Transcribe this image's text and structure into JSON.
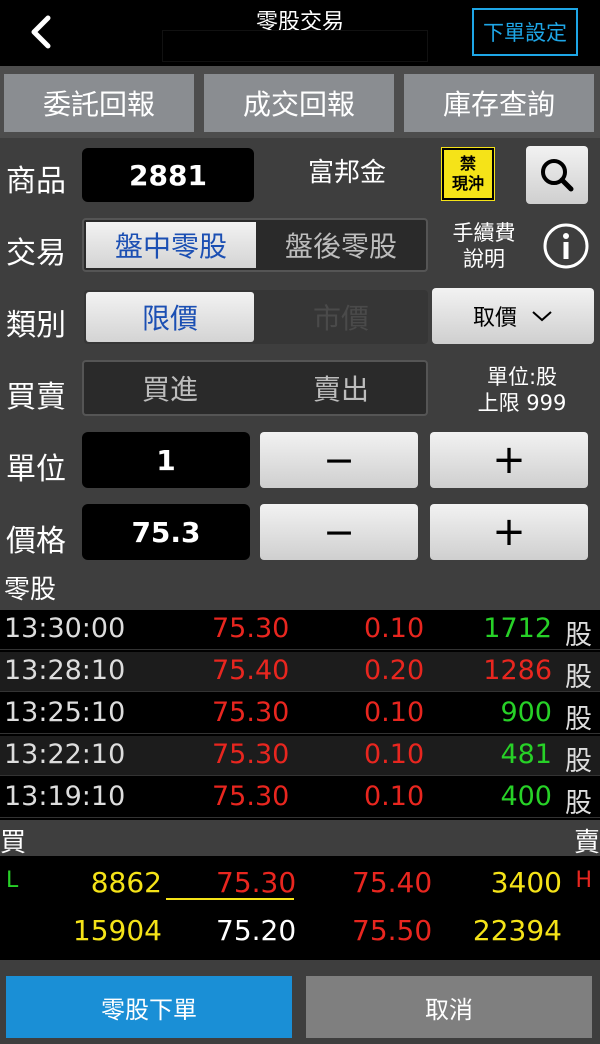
{
  "header": {
    "title": "零股交易",
    "setting_label": "下單設定",
    "back_icon": "chevron-left-icon"
  },
  "tabs": [
    {
      "label": "委託回報"
    },
    {
      "label": "成交回報"
    },
    {
      "label": "庫存查詢"
    }
  ],
  "form": {
    "product_label": "商品",
    "product_code": "2881",
    "product_name": "富邦金",
    "badge_line1": "禁",
    "badge_line2": "現沖",
    "search_icon": "search-icon",
    "trade_label": "交易",
    "trade_options": [
      "盤中零股",
      "盤後零股"
    ],
    "trade_selected": "盤中零股",
    "fee_line1": "手續費",
    "fee_line2": "說明",
    "info_icon": "info-icon",
    "type_label": "類別",
    "type_options": [
      "限價",
      "市價"
    ],
    "type_selected": "限價",
    "get_price_label": "取價",
    "buysell_label": "買賣",
    "buysell_options": [
      "買進",
      "賣出"
    ],
    "unit_info_line1": "單位:股",
    "unit_info_line2": "上限 999",
    "unit_label": "單位",
    "unit_value": "1",
    "price_label": "價格",
    "price_value": "75.3",
    "minus_symbol": "−",
    "plus_symbol": "+"
  },
  "trades": {
    "section_label": "零股",
    "unit": "股",
    "rows": [
      {
        "time": "13:30:00",
        "price": "75.30",
        "change": "0.10",
        "volume": "1712",
        "volume_color": "#27d127"
      },
      {
        "time": "13:28:10",
        "price": "75.40",
        "change": "0.20",
        "volume": "1286",
        "volume_color": "#e8261f"
      },
      {
        "time": "13:25:10",
        "price": "75.30",
        "change": "0.10",
        "volume": "900",
        "volume_color": "#27d127"
      },
      {
        "time": "13:22:10",
        "price": "75.30",
        "change": "0.10",
        "volume": "481",
        "volume_color": "#27d127"
      },
      {
        "time": "13:19:10",
        "price": "75.30",
        "change": "0.10",
        "volume": "400",
        "volume_color": "#27d127"
      }
    ]
  },
  "book": {
    "buy_label": "買",
    "sell_label": "賣",
    "low_marker": "L",
    "high_marker": "H",
    "row1": {
      "bid_qty": "8862",
      "bid_price": "75.30",
      "ask_price": "75.40",
      "ask_qty": "3400"
    },
    "row2": {
      "bid_qty": "15904",
      "bid_price": "75.20",
      "ask_price": "75.50",
      "ask_qty": "22394"
    }
  },
  "footer": {
    "order_label": "零股下單",
    "cancel_label": "取消"
  },
  "colors": {
    "accent": "#1ea6e6",
    "up_red": "#e8261f",
    "down_green": "#27d127",
    "qty_yellow": "#f5e318"
  }
}
